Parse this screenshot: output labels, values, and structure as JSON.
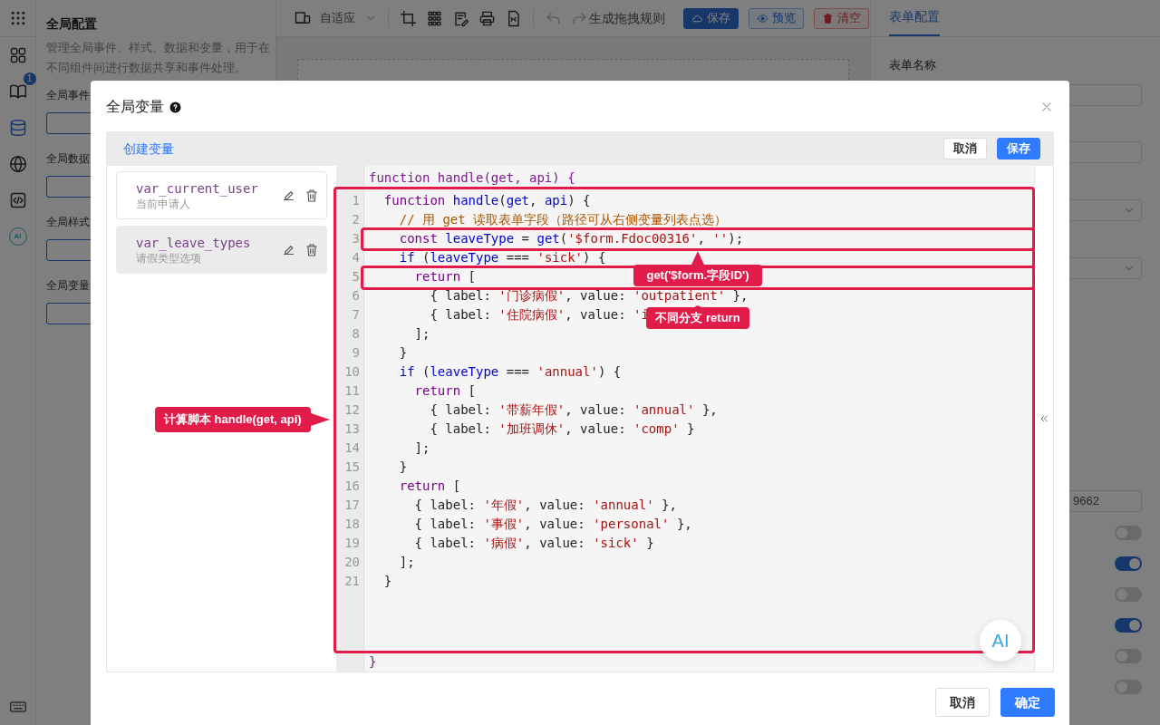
{
  "rail": {
    "items": [
      {
        "selected": false
      },
      {
        "selected": false,
        "badge": "1"
      },
      {
        "selected": true
      },
      {
        "selected": false
      },
      {
        "selected": false
      },
      {
        "selected": false,
        "label": "AI"
      }
    ]
  },
  "left_panel": {
    "title": "全局配置",
    "description": "管理全局事件、样式、数据和变量，用于在不同组件间进行数据共享和事件处理。",
    "sections": [
      "全局事件",
      "全局数据",
      "全局样式",
      "全局变量"
    ]
  },
  "toolbar": {
    "device_select": "自适应",
    "generate_rule": "生成拖拽规则",
    "buttons": [
      {
        "label": "保存",
        "kind": "primary"
      },
      {
        "label": "预览",
        "kind": "outline"
      },
      {
        "label": "清空",
        "kind": "danger"
      }
    ]
  },
  "right_panel": {
    "tabs": [
      {
        "label": "表单配置",
        "selected": true
      }
    ],
    "form_name_label": "表单名称",
    "id_value": "9662",
    "toggles": [
      {
        "on": false
      },
      {
        "on": true
      },
      {
        "on": false
      },
      {
        "on": true
      },
      {
        "on": false
      },
      {
        "on": false
      }
    ]
  },
  "modal": {
    "title": "全局变量",
    "create_link": "创建变量",
    "header_buttons": [
      {
        "label": "取消",
        "kind": "default"
      },
      {
        "label": "保存",
        "kind": "primary"
      }
    ],
    "variables": [
      {
        "name": "var_current_user",
        "description": "当前申请人",
        "selected": false
      },
      {
        "name": "var_leave_types",
        "description": "请假类型选项",
        "selected": true
      }
    ],
    "editor": {
      "header": "function handle(get, api) {",
      "footer": "}",
      "lines": [
        {
          "number": "1",
          "segments": [
            {
              "text": "  function ",
              "kind": "keyword"
            },
            {
              "text": "handle",
              "kind": "name"
            },
            {
              "text": "(",
              "kind": "plain"
            },
            {
              "text": "get",
              "kind": "name"
            },
            {
              "text": ", ",
              "kind": "plain"
            },
            {
              "text": "api",
              "kind": "name"
            },
            {
              "text": ") {",
              "kind": "plain"
            }
          ]
        },
        {
          "number": "2",
          "segments": [
            {
              "text": "    // 用 get 读取表单字段（路径可从右侧变量列表点选）",
              "kind": "comment"
            }
          ]
        },
        {
          "number": "3",
          "segments": [
            {
              "text": "    const ",
              "kind": "keyword"
            },
            {
              "text": "leaveType",
              "kind": "name"
            },
            {
              "text": " = ",
              "kind": "plain"
            },
            {
              "text": "get",
              "kind": "name"
            },
            {
              "text": "(",
              "kind": "plain"
            },
            {
              "text": "'$form.Fdoc00316'",
              "kind": "string"
            },
            {
              "text": ", ",
              "kind": "plain"
            },
            {
              "text": "''",
              "kind": "string"
            },
            {
              "text": ");",
              "kind": "plain"
            }
          ]
        },
        {
          "number": "4",
          "segments": [
            {
              "text": "    if",
              "kind": "name"
            },
            {
              "text": " (",
              "kind": "plain"
            },
            {
              "text": "leaveType",
              "kind": "name"
            },
            {
              "text": " === ",
              "kind": "plain"
            },
            {
              "text": "'sick'",
              "kind": "string"
            },
            {
              "text": ") {",
              "kind": "plain"
            }
          ]
        },
        {
          "number": "5",
          "segments": [
            {
              "text": "      return",
              "kind": "keyword"
            },
            {
              "text": " [",
              "kind": "plain"
            }
          ]
        },
        {
          "number": "6",
          "segments": [
            {
              "text": "        { label: ",
              "kind": "plain"
            },
            {
              "text": "'门诊病假'",
              "kind": "string"
            },
            {
              "text": ", value: ",
              "kind": "plain"
            },
            {
              "text": "'outpatient'",
              "kind": "string"
            },
            {
              "text": " },",
              "kind": "plain"
            }
          ]
        },
        {
          "number": "7",
          "segments": [
            {
              "text": "        { label: ",
              "kind": "plain"
            },
            {
              "text": "'住院病假'",
              "kind": "string"
            },
            {
              "text": ", value: ",
              "kind": "plain"
            },
            {
              "text": "'i",
              "kind": "string"
            }
          ]
        },
        {
          "number": "8",
          "segments": [
            {
              "text": "      ];",
              "kind": "plain"
            }
          ]
        },
        {
          "number": "9",
          "segments": [
            {
              "text": "    }",
              "kind": "plain"
            }
          ]
        },
        {
          "number": "10",
          "segments": [
            {
              "text": "    if",
              "kind": "name"
            },
            {
              "text": " (",
              "kind": "plain"
            },
            {
              "text": "leaveType",
              "kind": "name"
            },
            {
              "text": " === ",
              "kind": "plain"
            },
            {
              "text": "'annual'",
              "kind": "string"
            },
            {
              "text": ") {",
              "kind": "plain"
            }
          ]
        },
        {
          "number": "11",
          "segments": [
            {
              "text": "      return",
              "kind": "keyword"
            },
            {
              "text": " [",
              "kind": "plain"
            }
          ]
        },
        {
          "number": "12",
          "segments": [
            {
              "text": "        { label: ",
              "kind": "plain"
            },
            {
              "text": "'带薪年假'",
              "kind": "string"
            },
            {
              "text": ", value: ",
              "kind": "plain"
            },
            {
              "text": "'annual'",
              "kind": "string"
            },
            {
              "text": " },",
              "kind": "plain"
            }
          ]
        },
        {
          "number": "13",
          "segments": [
            {
              "text": "        { label: ",
              "kind": "plain"
            },
            {
              "text": "'加班调休'",
              "kind": "string"
            },
            {
              "text": ", value: ",
              "kind": "plain"
            },
            {
              "text": "'comp'",
              "kind": "string"
            },
            {
              "text": " }",
              "kind": "plain"
            }
          ]
        },
        {
          "number": "14",
          "segments": [
            {
              "text": "      ];",
              "kind": "plain"
            }
          ]
        },
        {
          "number": "15",
          "segments": [
            {
              "text": "    }",
              "kind": "plain"
            }
          ]
        },
        {
          "number": "16",
          "segments": [
            {
              "text": "    return",
              "kind": "keyword"
            },
            {
              "text": " [",
              "kind": "plain"
            }
          ]
        },
        {
          "number": "17",
          "segments": [
            {
              "text": "      { label: ",
              "kind": "plain"
            },
            {
              "text": "'年假'",
              "kind": "string"
            },
            {
              "text": ", value: ",
              "kind": "plain"
            },
            {
              "text": "'annual'",
              "kind": "string"
            },
            {
              "text": " },",
              "kind": "plain"
            }
          ]
        },
        {
          "number": "18",
          "segments": [
            {
              "text": "      { label: ",
              "kind": "plain"
            },
            {
              "text": "'事假'",
              "kind": "string"
            },
            {
              "text": ", value: ",
              "kind": "plain"
            },
            {
              "text": "'personal'",
              "kind": "string"
            },
            {
              "text": " },",
              "kind": "plain"
            }
          ]
        },
        {
          "number": "19",
          "segments": [
            {
              "text": "      { label: ",
              "kind": "plain"
            },
            {
              "text": "'病假'",
              "kind": "string"
            },
            {
              "text": ", value: ",
              "kind": "plain"
            },
            {
              "text": "'sick'",
              "kind": "string"
            },
            {
              "text": " }",
              "kind": "plain"
            }
          ]
        },
        {
          "number": "20",
          "segments": [
            {
              "text": "    ];",
              "kind": "plain"
            }
          ]
        },
        {
          "number": "21",
          "segments": [
            {
              "text": "  }",
              "kind": "plain"
            }
          ]
        }
      ]
    },
    "ai_button": "AI",
    "footer_buttons": [
      {
        "label": "取消",
        "kind": "default"
      },
      {
        "label": "确定",
        "kind": "primary"
      }
    ]
  },
  "callouts": [
    {
      "text": "get('$form.字段ID')"
    },
    {
      "text": "不同分支 return"
    },
    {
      "text": "计算脚本 handle(get, api)"
    }
  ]
}
